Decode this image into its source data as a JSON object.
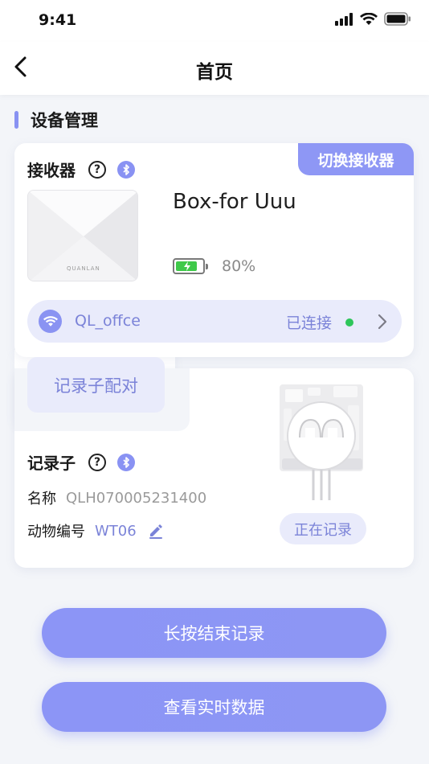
{
  "status_bar": {
    "time": "9:41"
  },
  "nav": {
    "title": "首页"
  },
  "section": {
    "title": "设备管理"
  },
  "receiver": {
    "label": "接收器",
    "switch_label": "切换接收器",
    "device_name": "Box-for Uuu",
    "brand": "QUANLAN",
    "battery_percent_text": "80%",
    "battery_level": 0.8,
    "wifi": {
      "name": "QL_offce",
      "status": "已连接"
    }
  },
  "pair": {
    "label": "记录子配对"
  },
  "recorder": {
    "label": "记录子",
    "name_key": "名称",
    "name_value": "QLH070005231400",
    "animal_key": "动物编号",
    "animal_value": "WT06",
    "status_badge": "正在记录"
  },
  "actions": {
    "stop_label": "长按结束记录",
    "view_label": "查看实时数据"
  },
  "colors": {
    "accent": "#8e97f5",
    "accent_light": "#e9ebfb",
    "accent_text": "#7b83d8",
    "connected_dot": "#2ec65a",
    "battery_green": "#3fc94a"
  },
  "icons": {
    "back": "chevron-left-icon",
    "help": "question-circle-icon",
    "bluetooth": "bluetooth-icon",
    "wifi": "wifi-icon",
    "battery": "battery-icon",
    "chevron": "chevron-right-icon",
    "edit": "pencil-icon"
  }
}
